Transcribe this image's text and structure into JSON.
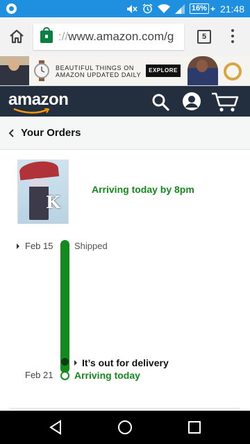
{
  "status_bar": {
    "battery_level": "16%",
    "time": "21:48"
  },
  "browser": {
    "url_scheme": "://",
    "url_host": "www.amazon.com/g",
    "tab_count": "5"
  },
  "ad": {
    "line1": "BEAUTIFUL THINGS ON",
    "line2": "AMAZON UPDATED DAILY",
    "cta": "EXPLORE"
  },
  "header": {
    "logo_text": "amazon",
    "icons": [
      "search-icon",
      "account-icon",
      "cart-icon"
    ]
  },
  "page": {
    "back_label": "Your Orders",
    "arrival_headline": "Arriving today by 8pm"
  },
  "timeline": {
    "events": [
      {
        "date": "Feb 15",
        "label": "Shipped"
      },
      {
        "date": "",
        "label": "It’s out for delivery"
      },
      {
        "date": "Feb 21",
        "label": "Arriving today"
      }
    ]
  },
  "colors": {
    "status_blue": "#1f8fe0",
    "amazon_navy": "#232f3e",
    "amazon_orange": "#ff9900",
    "delivery_green": "#138a1c"
  }
}
